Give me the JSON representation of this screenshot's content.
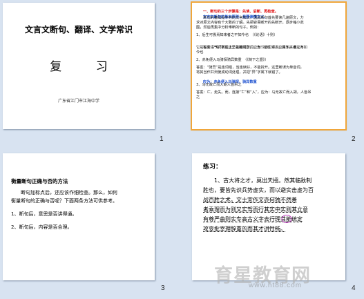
{
  "slides": [
    {
      "number": "1",
      "title": "文言文断句、翻译、文学常识",
      "subtitle": "复 习",
      "school": "广东省江门市江海中学"
    },
    {
      "number": "2",
      "lines": [
        "一、断句的三个步骤是：先读、后断、再检查。",
        "文言文断句的基本原则：是要读懂文义。",
        "　　断句的基础是平时的文言知识，因此断句首先要读几遍原文，力",
        "求对原文内容有个大致的了解。先把容易断开的先断开，逐步缩小范",
        "围，然后再集中分析难断的句子。例如：",
        "1、后生可畏焉知来者之不如今也　（《论语》十则）",
        "答案：“焉”字在这里是疑问副词，当“如何”讲，应属下。误以为",
        "它是句末语气词而属上，就断错了。应为：后生可畏，焉知来者之不如",
        "今也",
        "2、赤免便入马骑探骑异数重　（《荷下之盟》）",
        "答案：“骑异”是连词组，当连读好，不能拆开。这里断误为单音词，",
        "将其当作并列使成动词处理，并把“异”字属下就错了。",
        "应为：赤免便入马骑探，骑异数重",
        "3、马无故亡而入胡人皆吊之",
        "答案：亡，走失。而，连接“亡”和“入”，应为：马无故亡而入胡，人皆吊",
        "之"
      ]
    },
    {
      "number": "3",
      "title": "衡量断句正确与否的方法",
      "lines": [
        "　　断句加标点后，还应该作细检查。那么，如何",
        "衡量断句的正确与否呢？下面两条方法可供参考。",
        "1、断句后，意思是否讲得通。",
        "2、断句后，内容是否合理。"
      ]
    },
    {
      "number": "4",
      "title": "练习：",
      "lines": [
        "　　1、古大将之才，莫出天授。然其临敌制",
        "胜也，要皆先识兵势虚实，而以避实击虚为百",
        "战百胜之术。文士宜作文亦何独不然善",
        "者乘理而为则又实驾而行其实中实则其立意",
        "有尊严曲则实专高古义字去行理其能统定",
        "攻变批宰理辞重的而其才讲性畅。"
      ]
    }
  ],
  "watermark": {
    "text": "育星教育网",
    "url": "www.ht88.com"
  }
}
